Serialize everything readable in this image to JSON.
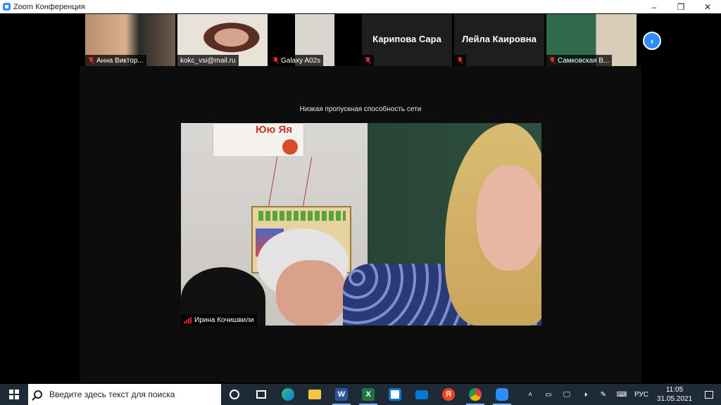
{
  "window": {
    "title": "Zoom Конференция",
    "controls": [
      "–",
      "❐",
      "✕"
    ]
  },
  "participants_strip": [
    {
      "name": "Анна Виктор...",
      "muted": true,
      "has_video": true
    },
    {
      "name": "kokc_vsi@mail.ru",
      "muted": false,
      "has_video": true
    },
    {
      "name": "Galaxy A02s",
      "muted": true,
      "has_video": true
    },
    {
      "name": "Карипова Сара",
      "muted": true,
      "has_video": false
    },
    {
      "name": "Лейла Каировна",
      "muted": true,
      "has_video": false
    },
    {
      "name": "Самковская В...",
      "muted": true,
      "has_video": true
    }
  ],
  "main_video": {
    "warning": "Низкая пропускная способность сети",
    "speaker_name": "Ирина Кочишвили",
    "poster_letters": "Юю  Яя"
  },
  "taskbar": {
    "search_placeholder": "Введите здесь текст для поиска",
    "language": "РУС",
    "time": "11:05",
    "date": "31.05.2021",
    "pinned_apps": [
      "cortana",
      "task-view",
      "edge",
      "file-explorer",
      "word",
      "excel",
      "store",
      "mail",
      "yandex",
      "chrome",
      "zoom"
    ],
    "yandex_label": "Я",
    "word_label": "W",
    "excel_label": "X"
  },
  "colors": {
    "zoom_blue": "#2d8cff",
    "muted_red": "#e0262e",
    "taskbar": "#1f2a37"
  }
}
